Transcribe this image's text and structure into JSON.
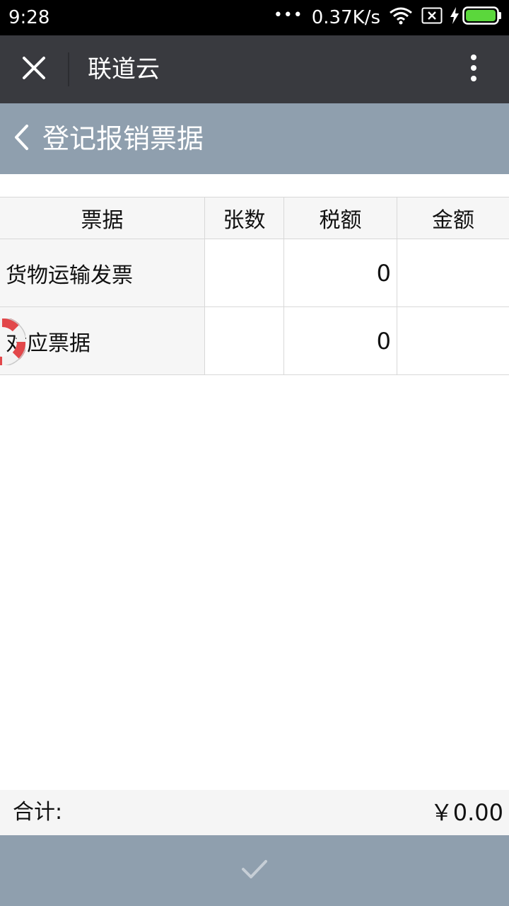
{
  "status_bar": {
    "time": "9:28",
    "dots": "•••",
    "speed": "0.37K/s",
    "icons": [
      "wifi-icon",
      "no-sim-icon",
      "charging-icon",
      "battery-icon"
    ],
    "battery_color": "#5bd73c"
  },
  "app_bar": {
    "title": "联道云",
    "icons": [
      "close-icon",
      "more-vertical-icon"
    ],
    "background": "#393a3f"
  },
  "page_header": {
    "title": "登记报销票据",
    "icon": "chevron-left-icon",
    "background": "#8f9fae"
  },
  "table": {
    "columns": [
      "票据",
      "张数",
      "税额",
      "金额"
    ],
    "rows": [
      {
        "name": "货物运输发票",
        "count": "",
        "tax": "0",
        "amount": ""
      },
      {
        "name": "对应票据",
        "count": "",
        "tax": "0",
        "amount": ""
      }
    ]
  },
  "floating": {
    "icon": "lifebuoy-icon"
  },
  "footer": {
    "total_label": "合计:",
    "total_value": "￥0.00",
    "confirm_icon": "checkmark-icon",
    "background": "#8f9fae"
  }
}
